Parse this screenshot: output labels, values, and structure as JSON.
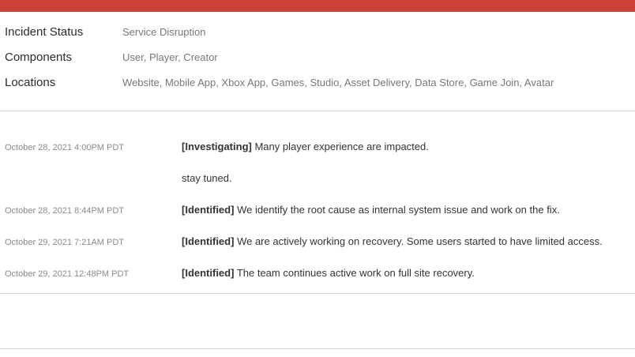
{
  "accent_color": "#cc4136",
  "incident": {
    "status_label": "Incident Status",
    "status_value": "Service Disruption",
    "components_label": "Components",
    "components_value": "User, Player, Creator",
    "locations_label": "Locations",
    "locations_value": "Website, Mobile App, Xbox App, Games, Studio, Asset Delivery, Data Store, Game Join, Avatar"
  },
  "updates": [
    {
      "time": "October 28, 2021 4:00PM PDT",
      "status": "[Investigating]",
      "message": "Many player experience are impacted."
    },
    {
      "time": "",
      "status": "",
      "message": "stay tuned."
    },
    {
      "time": "October 28, 2021 8:44PM PDT",
      "status": "[Identified]",
      "message": "We identify the root cause as internal system issue and work on the fix."
    },
    {
      "time": "October 29, 2021 7:21AM PDT",
      "status": "[Identified]",
      "message": "We are actively working on recovery. Some users started to have limited access."
    },
    {
      "time": "October 29, 2021 12:48PM PDT",
      "status": "[Identified]",
      "message": "The team continues active work on full site recovery."
    }
  ]
}
